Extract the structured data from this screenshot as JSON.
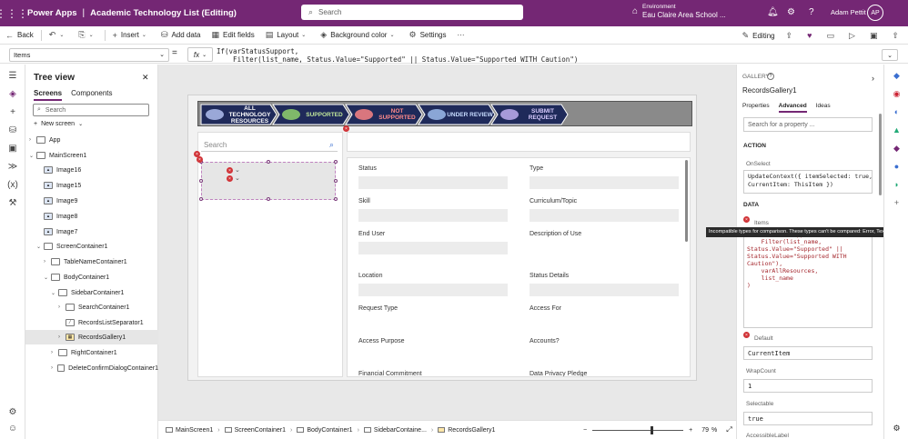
{
  "titlebar": {
    "app_name": "Power Apps",
    "separator": "|",
    "doc_title": "Academic Technology List (Editing)",
    "search_placeholder": "Search",
    "env_label": "Environment",
    "env_value": "Eau Claire Area School ...",
    "user_name": "Adam Pettit",
    "user_initials": "AP"
  },
  "commandbar": {
    "back": "Back",
    "insert": "Insert",
    "add_data": "Add data",
    "edit_fields": "Edit fields",
    "layout": "Layout",
    "background_color": "Background color",
    "settings": "Settings",
    "more": "···",
    "editing": "Editing"
  },
  "formulabar": {
    "property": "Items",
    "equals": "=",
    "fx": "fx",
    "formula_line1": "If(varStatusSupport,",
    "formula_line2": "    Filter(list_name, Status.Value=\"Supported\" || Status.Value=\"Supported WITH Caution\")"
  },
  "treeview": {
    "title": "Tree view",
    "tabs": [
      "Screens",
      "Components"
    ],
    "search_placeholder": "Search",
    "new_screen": "New screen",
    "nodes": [
      {
        "label": "App"
      },
      {
        "label": "MainScreen1"
      },
      {
        "label": "Image16"
      },
      {
        "label": "Image15"
      },
      {
        "label": "Image9"
      },
      {
        "label": "Image8"
      },
      {
        "label": "Image7"
      },
      {
        "label": "ScreenContainer1"
      },
      {
        "label": "TableNameContainer1"
      },
      {
        "label": "BodyContainer1"
      },
      {
        "label": "SidebarContainer1"
      },
      {
        "label": "SearchContainer1"
      },
      {
        "label": "RecordsListSeparator1"
      },
      {
        "label": "RecordsGallery1"
      },
      {
        "label": "RightContainer1"
      },
      {
        "label": "DeleteConfirmDialogContainer1"
      }
    ]
  },
  "canvas": {
    "nav_steps": [
      {
        "label": "ALL TECHNOLOGY RESOURCES",
        "emblem_color": "#9aa8d8"
      },
      {
        "label": "SUPPORTED",
        "emblem_color": "#7fb86a"
      },
      {
        "label": "NOT SUPPORTED",
        "emblem_color": "#d9767e"
      },
      {
        "label": "UNDER REVIEW",
        "emblem_color": "#8aa6d6"
      },
      {
        "label": "SUBMIT REQUEST",
        "emblem_color": "#a69ad8"
      }
    ],
    "gallery_search_placeholder": "Search",
    "fields": [
      {
        "label": "Status"
      },
      {
        "label": "Type"
      },
      {
        "label": "Skill"
      },
      {
        "label": "Curriculum/Topic"
      },
      {
        "label": "End User"
      },
      {
        "label": "Description of Use"
      },
      {
        "label": "Location"
      },
      {
        "label": "Status Details"
      },
      {
        "label": "Request Type"
      },
      {
        "label": "Access For"
      },
      {
        "label": "Access Purpose"
      },
      {
        "label": "Accounts?"
      },
      {
        "label": "Financial Commitment"
      },
      {
        "label": "Data Privacy Pledge"
      }
    ]
  },
  "statusbar": {
    "crumbs": [
      "MainScreen1",
      "ScreenContainer1",
      "BodyContainer1",
      "SidebarContaine...",
      "RecordsGallery1"
    ],
    "zoom_minus": "−",
    "zoom_plus": "+",
    "zoom_value": "79",
    "zoom_unit": "%",
    "zoom_fraction": 0.79
  },
  "properties": {
    "control_type": "GALLERY",
    "control_name": "RecordsGallery1",
    "tabs": [
      "Properties",
      "Advanced",
      "Ideas"
    ],
    "search_placeholder": "Search for a property ...",
    "section_action": "ACTION",
    "onselect_label": "OnSelect",
    "onselect_value": "UpdateContext({ itemSelected: true,\nCurrentItem: ThisItem })",
    "section_data": "DATA",
    "items_label": "Items",
    "items_value": "If(varStatusSupport,\n    Filter(list_name,\nStatus.Value=\"Supported\" ||\nStatus.Value=\"Supported WITH\nCaution\"),\n    varAllResources,\n    list_name\n)",
    "default_label": "Default",
    "default_value": "CurrentItem",
    "wrapcount_label": "WrapCount",
    "wrapcount_value": "1",
    "selectable_label": "Selectable",
    "selectable_value": "true",
    "accessiblelabel_label": "AccessibleLabel",
    "tooltip": "Incompatible types for comparison. These types can't be compared: Error, Text."
  },
  "colors": {
    "brand": "#742774",
    "error": "#d13438"
  }
}
